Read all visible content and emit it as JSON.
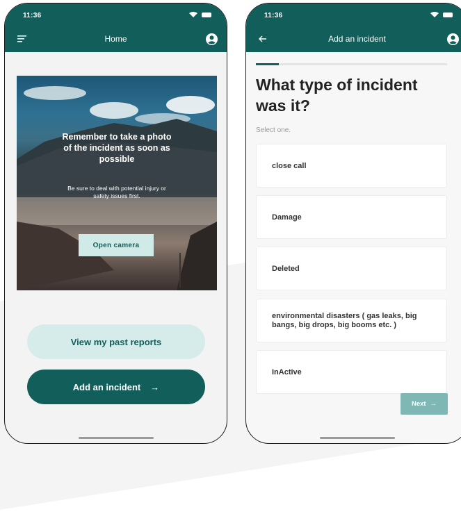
{
  "left_screen": {
    "status_time": "11:36",
    "title": "Home",
    "hero": {
      "title": "Remember to take a photo of the incident as soon as possible",
      "subtitle": "Be sure to deal with potential injury or safety issues first.",
      "button_label": "Open camera"
    },
    "past_reports_label": "View my past reports",
    "add_incident_label": "Add an incident",
    "add_incident_arrow": "→"
  },
  "right_screen": {
    "status_time": "11:36",
    "title": "Add an incident",
    "progress": 0.12,
    "question": "What type of incident was it?",
    "helper": "Select one.",
    "options": [
      "close call",
      "Damage",
      "Deleted",
      "environmental disasters ( gas leaks, big bangs, big drops, big booms etc. )",
      "InActive"
    ],
    "next_label": "Next",
    "next_arrow": "→"
  },
  "icons": [
    "menu-icon",
    "profile-icon",
    "back-arrow-icon",
    "wifi-icon",
    "battery-icon",
    "arrow-right-icon"
  ],
  "colors": {
    "primary": "#125e5a",
    "primary_light": "#d6ecea",
    "next_disabled": "#7eb7b4"
  }
}
